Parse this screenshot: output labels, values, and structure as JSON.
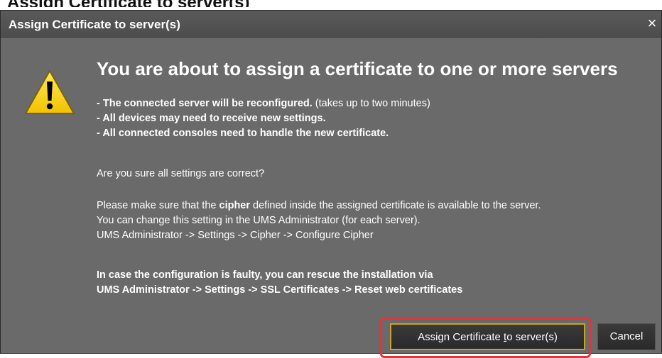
{
  "outer_caption": "Assign Certificate to server(s)",
  "window": {
    "title": "Assign Certificate to server(s)",
    "close_label": "×"
  },
  "dialog": {
    "heading": "You are about to assign a certificate to one or more servers",
    "lines": {
      "l1_bold": "- The connected server will be reconfigured.",
      "l1_note": " (takes up to two minutes)",
      "l2": "- All devices may need to receive new settings.",
      "l3": "- All connected consoles need to handle the new certificate.",
      "question": "Are you sure all settings are correct?",
      "cipher_pre": "Please make sure that the ",
      "cipher_word": "cipher",
      "cipher_post": " defined inside the assigned certificate is available to the server.",
      "cipher_l2": "You can change this setting in the UMS Administrator (for each server).",
      "cipher_l3": "UMS Administrator -> Settings -> Cipher -> Configure Cipher",
      "rescue_l1": "In case the configuration is faulty, you can rescue the installation via",
      "rescue_l2": "UMS Administrator -> Settings -> SSL Certificates -> Reset web certificates"
    }
  },
  "buttons": {
    "assign_pre": "Assign Certificate ",
    "assign_mnemonic": "t",
    "assign_mid": "o",
    "assign_post": " server(s)",
    "cancel": "Cancel"
  },
  "icons": {
    "warning": "warning-triangle-icon",
    "close": "close-icon"
  },
  "colors": {
    "dialog_bg": "#6a6a6a",
    "titlebar_bg": "#4f4f4f",
    "warning_yellow": "#f5d31c",
    "focus_border": "#c9a227",
    "highlight_red": "#e3343a"
  }
}
